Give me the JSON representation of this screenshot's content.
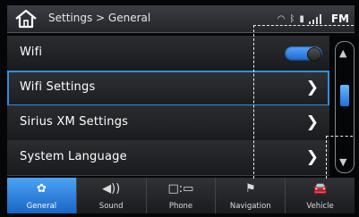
{
  "header": {
    "breadcrumb": "Settings > General",
    "band": "FM",
    "icons": [
      "home-icon",
      "wifi-signal-icon",
      "bluetooth-icon",
      "battery-icon",
      "cell-signal-icon"
    ]
  },
  "settings": {
    "wifi": {
      "label": "Wifi",
      "enabled": true
    },
    "items": [
      {
        "label": "Wifi Settings",
        "selected": true
      },
      {
        "label": "Sirius XM Settings",
        "selected": false
      },
      {
        "label": "System Language",
        "selected": false
      }
    ],
    "chevron": "❯"
  },
  "scrollbar": {
    "up": "▲",
    "down": "▼"
  },
  "tabs": [
    {
      "label": "General",
      "icon": "gear-icon",
      "glyph": "✿",
      "active": true
    },
    {
      "label": "Sound",
      "icon": "speaker-icon",
      "glyph": "◀))",
      "active": false
    },
    {
      "label": "Phone",
      "icon": "phone-icon",
      "glyph": "□:▭",
      "active": false
    },
    {
      "label": "Navigation",
      "icon": "navigation-icon",
      "glyph": "⚑",
      "active": false
    },
    {
      "label": "Vehicle",
      "icon": "car-icon",
      "glyph": "🚘",
      "active": false
    }
  ],
  "colors": {
    "accent": "#2c8fe0",
    "active_tab": "#1f77d6",
    "toggle_on": "#3b8ef0"
  }
}
